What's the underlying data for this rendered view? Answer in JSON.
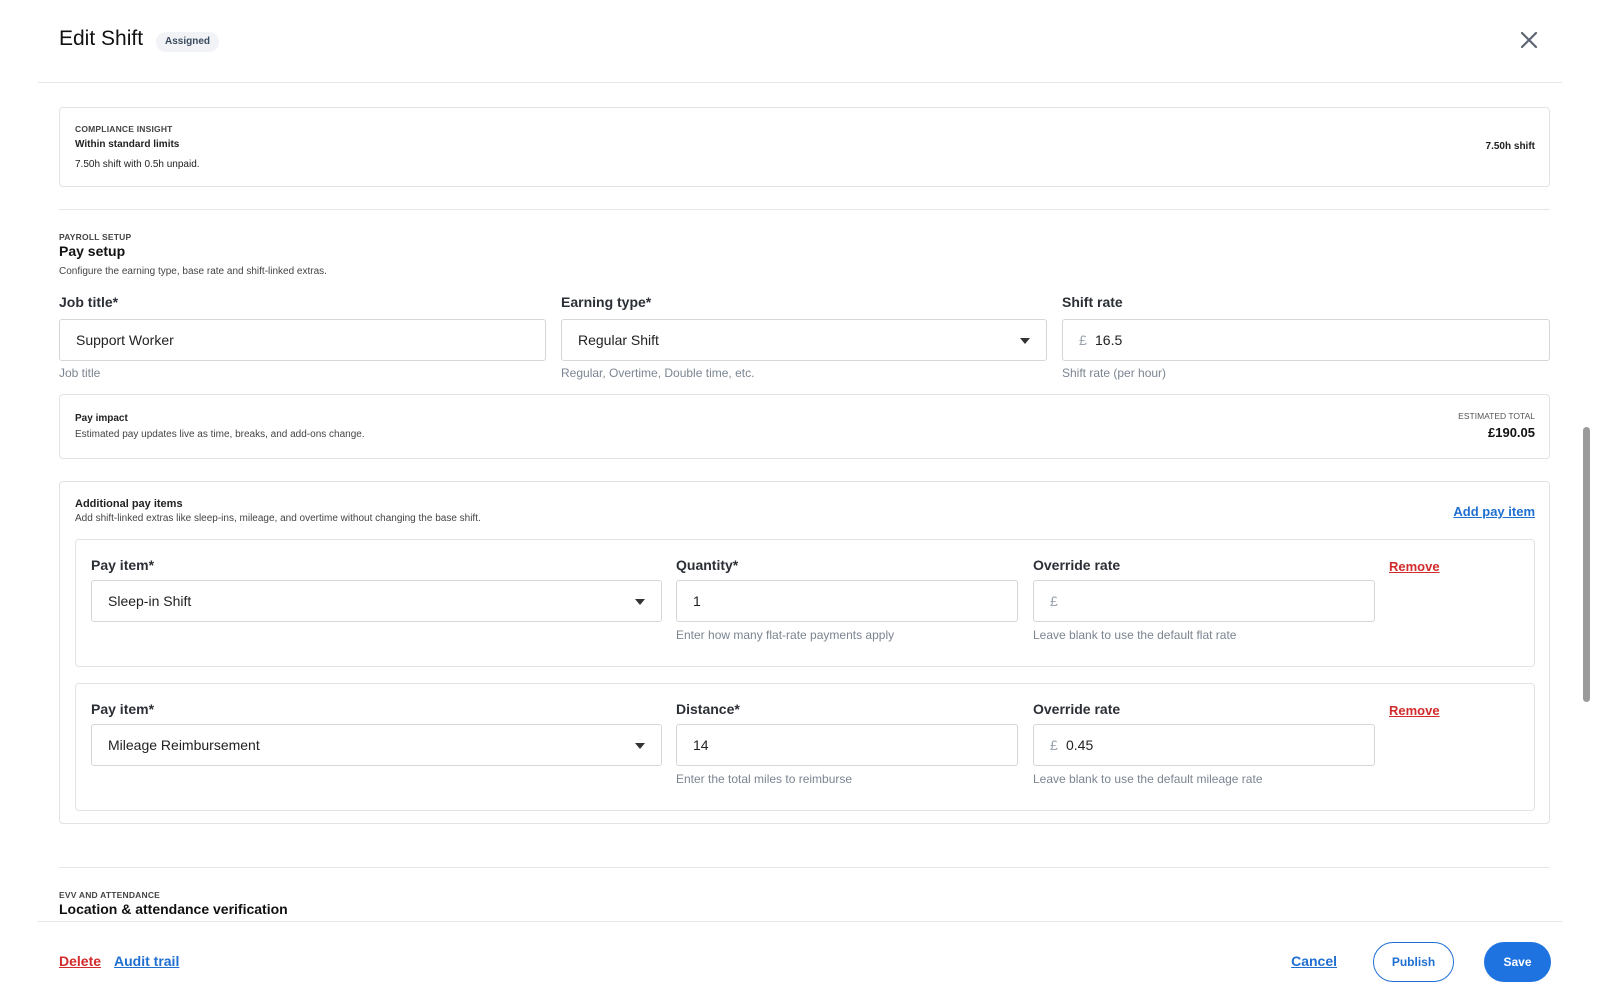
{
  "header": {
    "title": "Edit Shift",
    "status_badge": "Assigned"
  },
  "compliance": {
    "eyebrow": "COMPLIANCE INSIGHT",
    "heading": "Within standard limits",
    "detail": "7.50h shift with 0.5h unpaid.",
    "duration": "7.50h shift"
  },
  "payroll": {
    "eyebrow": "PAYROLL SETUP",
    "heading": "Pay setup",
    "description": "Configure the earning type, base rate and shift-linked extras.",
    "job_title": {
      "label": "Job title*",
      "value": "Support Worker",
      "helper": "Job title"
    },
    "earning_type": {
      "label": "Earning type*",
      "value": "Regular Shift",
      "helper": "Regular, Overtime, Double time, etc."
    },
    "shift_rate": {
      "label": "Shift rate",
      "currency": "£",
      "value": "16.5",
      "helper": "Shift rate (per hour)"
    },
    "pay_impact": {
      "heading": "Pay impact",
      "detail": "Estimated pay updates live as time, breaks, and add-ons change.",
      "total_label": "ESTIMATED TOTAL",
      "total_value": "£190.05"
    }
  },
  "additional": {
    "heading": "Additional pay items",
    "description": "Add shift-linked extras like sleep-ins, mileage, and overtime without changing the base shift.",
    "add_label": "Add pay item",
    "items": [
      {
        "pay_item_label": "Pay item*",
        "pay_item_value": "Sleep-in Shift",
        "qty_label": "Quantity*",
        "qty_value": "1",
        "qty_helper": "Enter how many flat-rate payments apply",
        "override_label": "Override rate",
        "override_currency": "£",
        "override_value": "",
        "override_helper": "Leave blank to use the default flat rate",
        "remove_label": "Remove"
      },
      {
        "pay_item_label": "Pay item*",
        "pay_item_value": "Mileage Reimbursement",
        "qty_label": "Distance*",
        "qty_value": "14",
        "qty_helper": "Enter the total miles to reimburse",
        "override_label": "Override rate",
        "override_currency": "£",
        "override_value": "0.45",
        "override_helper": "Leave blank to use the default mileage rate",
        "remove_label": "Remove"
      }
    ]
  },
  "evv": {
    "eyebrow": "EVV AND ATTENDANCE",
    "heading": "Location & attendance verification"
  },
  "footer": {
    "delete_label": "Delete",
    "audit_label": "Audit trail",
    "cancel_label": "Cancel",
    "publish_label": "Publish",
    "save_label": "Save"
  },
  "colors": {
    "accent": "#1f6fd1",
    "danger": "#d22b2b",
    "save_button": "#1f73e0"
  }
}
